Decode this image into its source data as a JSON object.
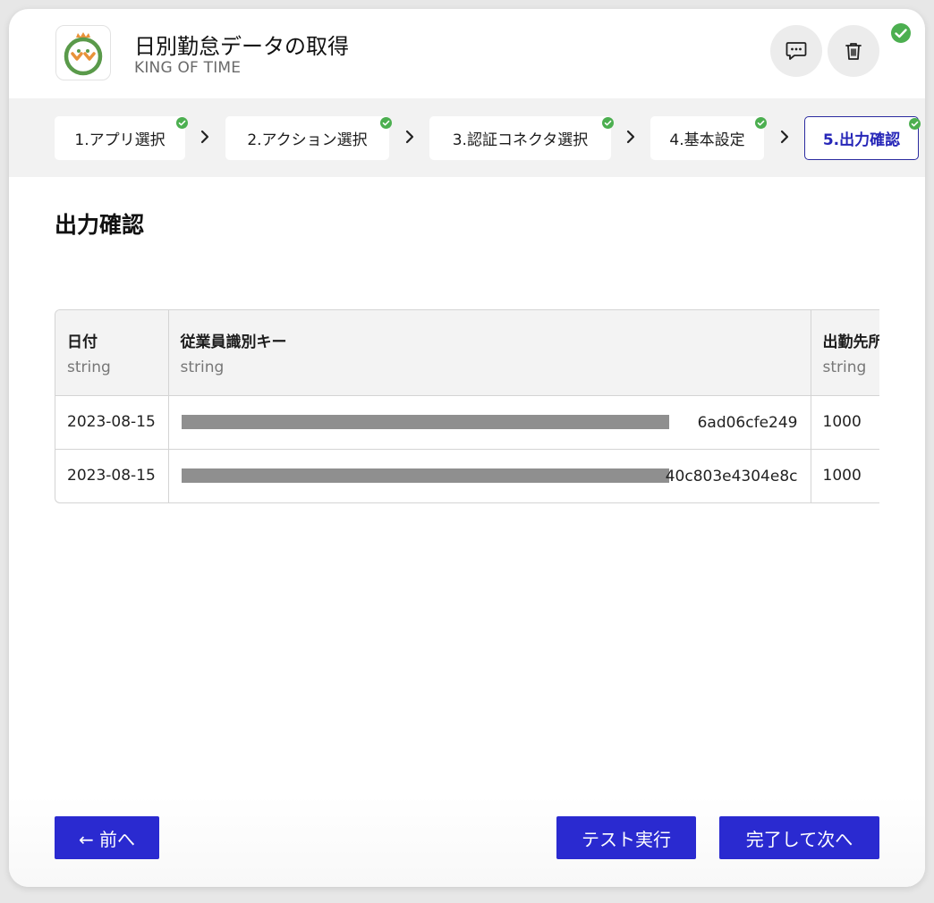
{
  "header": {
    "title": "日別勤怠データの取得",
    "subtitle": "KING OF TIME",
    "icons": [
      "comment-icon",
      "trash-icon",
      "check-circle-icon"
    ],
    "accent": "#2a2ad0",
    "success": "#4caf50"
  },
  "steps": [
    {
      "label": "1.アプリ選択",
      "done": true
    },
    {
      "label": "2.アクション選択",
      "done": true
    },
    {
      "label": "3.認証コネクタ選択",
      "done": true
    },
    {
      "label": "4.基本設定",
      "done": true
    },
    {
      "label": "5.出力確認",
      "done": true,
      "active": true
    }
  ],
  "section": {
    "title": "出力確認"
  },
  "table": {
    "columns": [
      {
        "name": "日付",
        "type": "string"
      },
      {
        "name": "従業員識別キー",
        "type": "string"
      },
      {
        "name": "出勤先所",
        "type": "string"
      }
    ],
    "rows": [
      {
        "date": "2023-08-15",
        "key_suffix": "6ad06cfe249",
        "location": "1000"
      },
      {
        "date": "2023-08-15",
        "key_suffix": "40c803e4304e8c",
        "location": "1000"
      }
    ]
  },
  "footer": {
    "prev_label": "← 前へ",
    "test_label": "テスト実行",
    "next_label": "完了して次へ"
  }
}
